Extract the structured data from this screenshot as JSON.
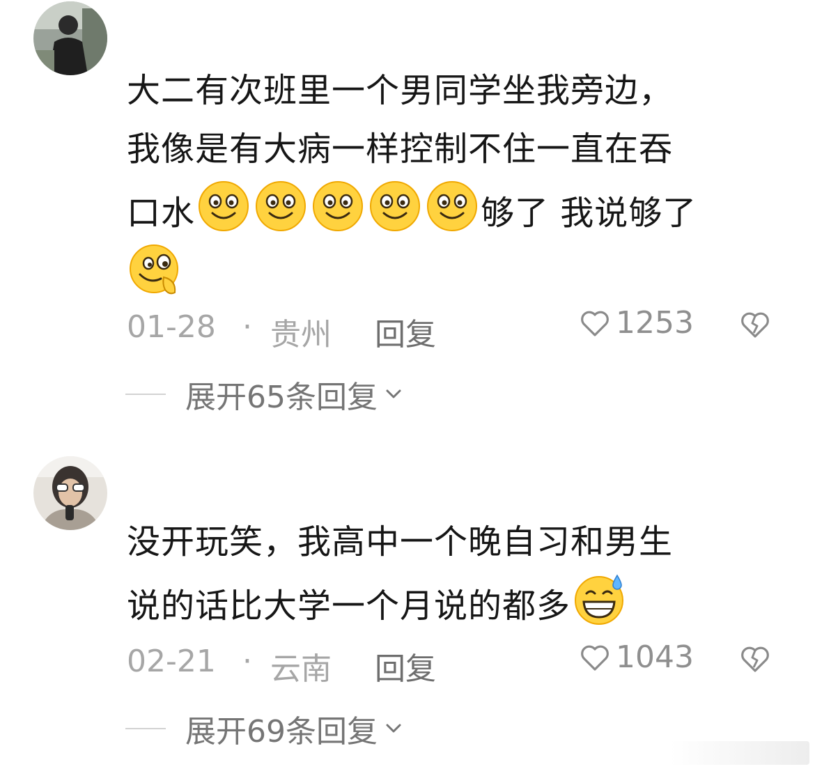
{
  "comments": [
    {
      "text_parts": [
        "大二有次班里一个男同学坐我旁边，",
        "我像是有大病一样控制不住一直在吞",
        "口水"
      ],
      "emoji_count": 5,
      "text_after_emoji": "够了 我说够了",
      "final_emoji": "drool-face-emoji",
      "date": "01-28",
      "separator": "·",
      "location": "贵州",
      "reply_label": "回复",
      "like_count": "1253",
      "expand_label": "展开65条回复"
    },
    {
      "text_parts": [
        "没开玩笑，我高中一个晚自习和男生",
        "说的话比大学一个月说的都多"
      ],
      "final_emoji": "sweat-grin-emoji",
      "date": "02-21",
      "separator": "·",
      "location": "云南",
      "reply_label": "回复",
      "like_count": "1043",
      "expand_label": "展开69条回复"
    }
  ],
  "colors": {
    "text": "#161616",
    "meta": "#a6a6a6",
    "reply": "#6e6e6e",
    "emoji_yellow": "#ffd23f"
  }
}
